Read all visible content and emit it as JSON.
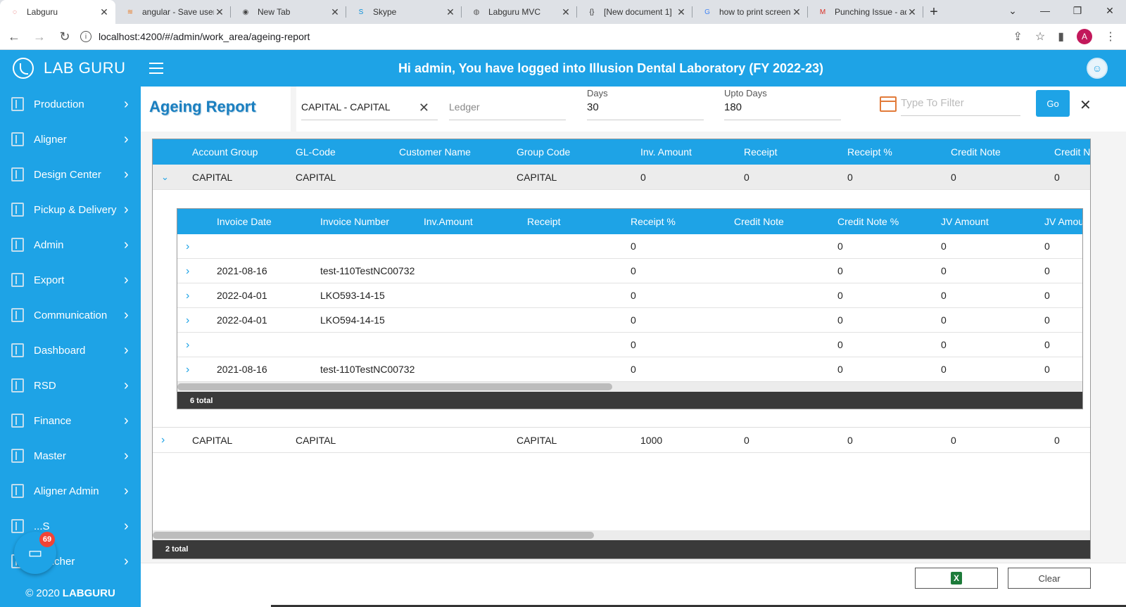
{
  "browser": {
    "tabs": [
      {
        "title": "Labguru",
        "active": true,
        "icon": "labguru-favicon"
      },
      {
        "title": "angular - Save user",
        "active": false,
        "icon": "stackoverflow-favicon"
      },
      {
        "title": "New Tab",
        "active": false,
        "icon": "chrome-favicon"
      },
      {
        "title": "Skype",
        "active": false,
        "icon": "skype-favicon"
      },
      {
        "title": "Labguru MVC",
        "active": false,
        "icon": "globe-favicon"
      },
      {
        "title": "[New document 1]",
        "active": false,
        "icon": "braces-favicon"
      },
      {
        "title": "how to print screen",
        "active": false,
        "icon": "google-favicon"
      },
      {
        "title": "Punching Issue - ad",
        "active": false,
        "icon": "gmail-favicon"
      }
    ],
    "url": "localhost:4200/#/admin/work_area/ageing-report",
    "profile_initial": "A"
  },
  "header": {
    "brand": "LAB GURU",
    "welcome": "Hi admin, You have logged into Illusion Dental Laboratory (FY 2022-23)"
  },
  "sidebar": {
    "items": [
      {
        "label": "Production"
      },
      {
        "label": "Aligner"
      },
      {
        "label": "Design Center"
      },
      {
        "label": "Pickup & Delivery"
      },
      {
        "label": "Admin"
      },
      {
        "label": "Export"
      },
      {
        "label": "Communication"
      },
      {
        "label": "Dashboard"
      },
      {
        "label": "RSD"
      },
      {
        "label": "Finance"
      },
      {
        "label": "Master"
      },
      {
        "label": "Aligner Admin"
      },
      {
        "label": "...S"
      },
      {
        "label": "...oucher"
      }
    ],
    "footer_prefix": "© 2020",
    "footer_brand": "LABGURU"
  },
  "chat": {
    "badge": "69"
  },
  "filters": {
    "title": "Ageing Report",
    "account": "CAPITAL - CAPITAL",
    "ledger_placeholder": "Ledger",
    "days_label": "Days",
    "days_value": "30",
    "upto_label": "Upto Days",
    "upto_value": "180",
    "filter_placeholder": "Type To Filter",
    "go_label": "Go"
  },
  "outer_grid": {
    "columns": [
      "Account Group",
      "GL-Code",
      "Customer Name",
      "Group Code",
      "Inv. Amount",
      "Receipt",
      "Receipt %",
      "Credit Note",
      "Credit N"
    ],
    "rows": [
      [
        "CAPITAL",
        "CAPITAL",
        "",
        "CAPITAL",
        "0",
        "0",
        "0",
        "0",
        "0"
      ],
      [
        "CAPITAL",
        "CAPITAL",
        "",
        "CAPITAL",
        "1000",
        "0",
        "0",
        "0",
        "0"
      ]
    ],
    "footer": "2 total",
    "scroll_fraction": 0.47
  },
  "inner_grid": {
    "columns": [
      "Invoice Date",
      "Invoice Number",
      "Inv.Amount",
      "Receipt",
      "Receipt %",
      "Credit Note",
      "Credit Note %",
      "JV Amount",
      "JV Amou"
    ],
    "rows": [
      [
        "",
        "",
        "",
        "",
        "0",
        "",
        "0",
        "0",
        "0"
      ],
      [
        "2021-08-16",
        "test-110TestNC00732",
        "",
        "",
        "0",
        "",
        "0",
        "0",
        "0"
      ],
      [
        "2022-04-01",
        "LKO593-14-15",
        "",
        "",
        "0",
        "",
        "0",
        "0",
        "0"
      ],
      [
        "2022-04-01",
        "LKO594-14-15",
        "",
        "",
        "0",
        "",
        "0",
        "0",
        "0"
      ],
      [
        "",
        "",
        "",
        "",
        "0",
        "",
        "0",
        "0",
        "0"
      ],
      [
        "2021-08-16",
        "test-110TestNC00732",
        "",
        "",
        "0",
        "",
        "0",
        "0",
        "0"
      ]
    ],
    "footer": "6 total",
    "scroll_fraction": 0.48
  },
  "bottom": {
    "clear_label": "Clear"
  }
}
